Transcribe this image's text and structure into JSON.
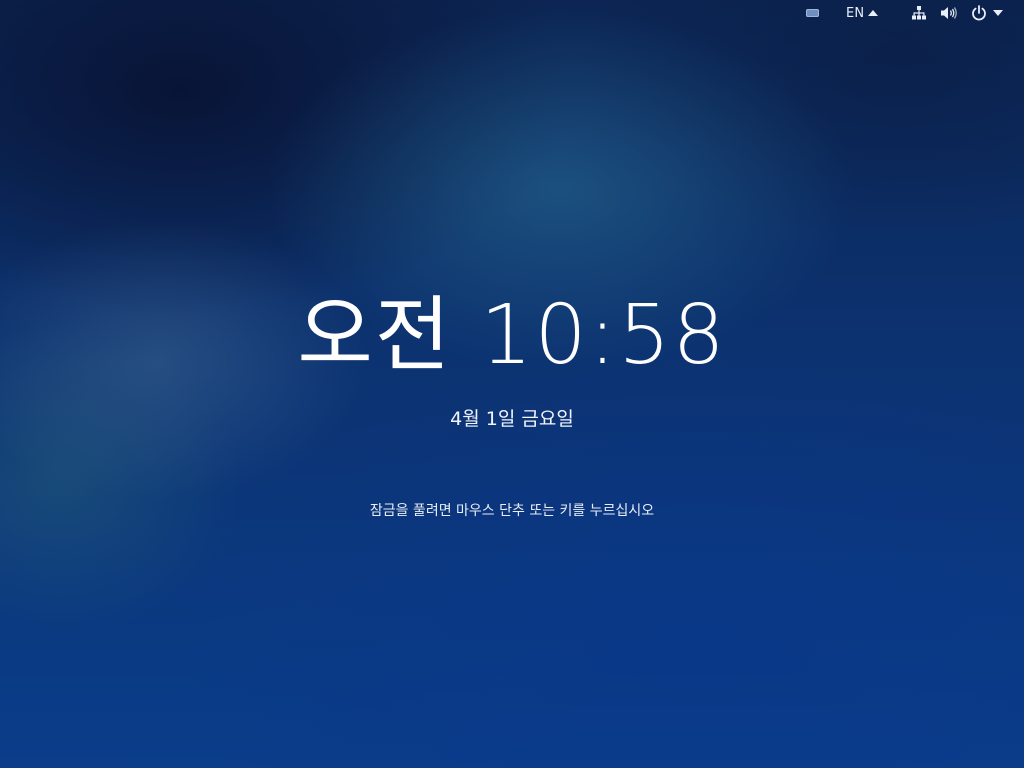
{
  "topbar": {
    "keyboard_icon": "keyboard-icon",
    "input_source": "EN",
    "network_icon": "network-wired-icon",
    "volume_icon": "volume-icon",
    "power_icon": "power-icon"
  },
  "lockscreen": {
    "time": "오전 10:58",
    "date": "4월 1일 금요일",
    "hint": "잠금을 풀려면 마우스 단추 또는 키를 누르십시오"
  },
  "colors": {
    "background_top": "#0c2553",
    "background_bottom": "#0a3d8a",
    "text": "#ffffff"
  }
}
